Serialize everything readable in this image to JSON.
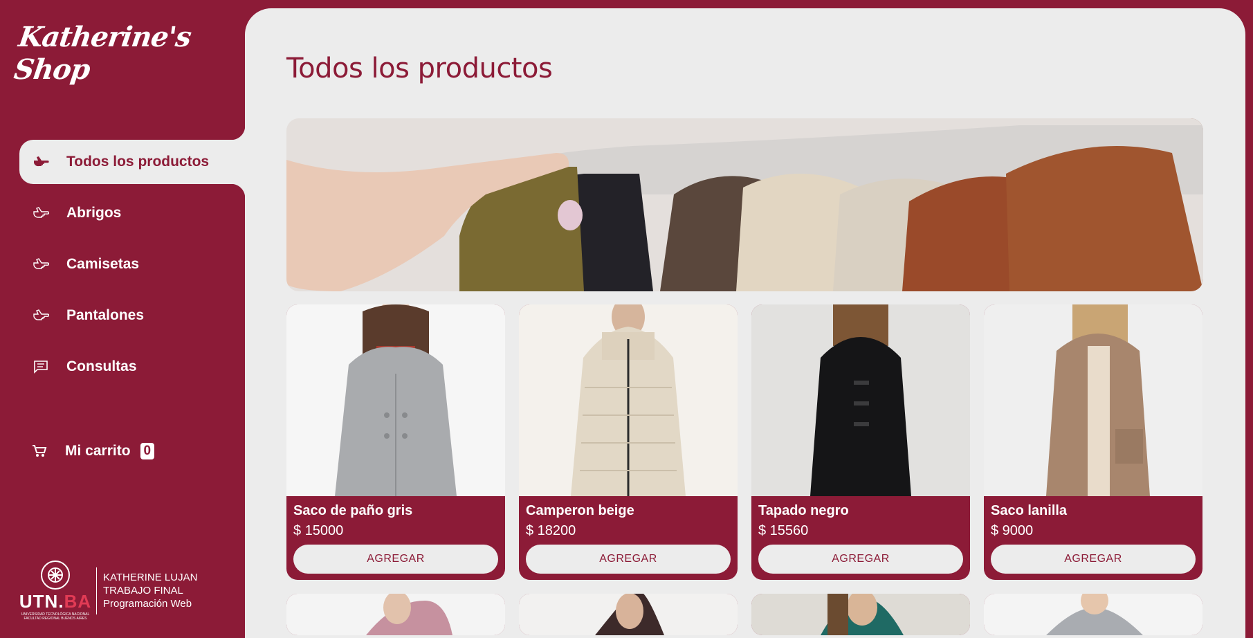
{
  "brand": {
    "logo_text": "Katherine's Shop"
  },
  "sidebar": {
    "items": [
      {
        "label": "Todos los productos",
        "icon": "hand-pointing-icon",
        "active": true
      },
      {
        "label": "Abrigos",
        "icon": "hand-pointing-icon"
      },
      {
        "label": "Camisetas",
        "icon": "hand-pointing-icon"
      },
      {
        "label": "Pantalones",
        "icon": "hand-pointing-icon"
      },
      {
        "label": "Consultas",
        "icon": "chat-icon"
      }
    ],
    "cart": {
      "label": "Mi carrito",
      "count": "0",
      "icon": "cart-icon"
    },
    "footer": {
      "utn_prefix": "UTN.",
      "utn_suffix": "BA",
      "utn_sub1": "UNIVERSIDAD TECNOLÓGICA NACIONAL",
      "utn_sub2": "FACULTAD REGIONAL BUENOS AIRES",
      "line1": "KATHERINE LUJAN",
      "line2": "TRABAJO FINAL",
      "line3": "Programación Web"
    }
  },
  "main": {
    "title": "Todos los productos",
    "products": [
      {
        "name": "Saco de paño gris",
        "price": "$ 15000",
        "button": "AGREGAR"
      },
      {
        "name": "Camperon beige",
        "price": "$ 18200",
        "button": "AGREGAR"
      },
      {
        "name": "Tapado negro",
        "price": "$ 15560",
        "button": "AGREGAR"
      },
      {
        "name": "Saco lanilla",
        "price": "$ 9000",
        "button": "AGREGAR"
      }
    ]
  },
  "colors": {
    "brand": "#8c1b37",
    "panel": "#ececec"
  }
}
